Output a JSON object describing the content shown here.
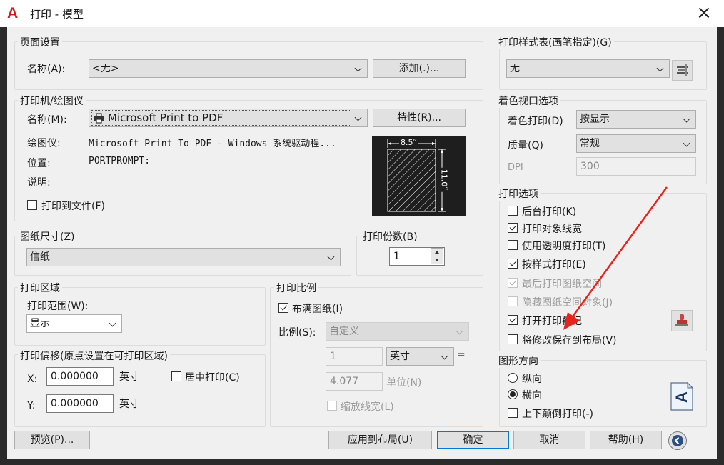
{
  "window": {
    "title": "打印 - 模型",
    "logo": "A",
    "close": "×"
  },
  "page_setup": {
    "group": "页面设置",
    "name_label": "名称(A):",
    "name_value": "<无>",
    "add_button": "添加(.)..."
  },
  "plotter": {
    "group": "打印机/绘图仪",
    "name_label": "名称(M):",
    "printer_value": "Microsoft Print to PDF",
    "properties_button": "特性(R)...",
    "plotter_label": "绘图仪:",
    "plotter_value": "Microsoft Print To PDF - Windows 系统驱动程...",
    "location_label": "位置:",
    "location_value": "PORTPROMPT:",
    "desc_label": "说明:",
    "print_to_file": "打印到文件(F)",
    "preview_width": "8.5′′",
    "preview_height": "11.0′′"
  },
  "paper": {
    "group": "图纸尺寸(Z)",
    "value": "信纸"
  },
  "copies": {
    "group": "打印份数(B)",
    "value": "1"
  },
  "area": {
    "group": "打印区域",
    "range_label": "打印范围(W):",
    "range_value": "显示"
  },
  "offset": {
    "group": "打印偏移(原点设置在可打印区域)",
    "x_label": "X:",
    "x_value": "0.000000",
    "x_unit": "英寸",
    "y_label": "Y:",
    "y_value": "0.000000",
    "y_unit": "英寸",
    "center": "居中打印(C)"
  },
  "scale": {
    "group": "打印比例",
    "fit": "布满图纸(I)",
    "scale_label": "比例(S):",
    "scale_value": "自定义",
    "v1": "1",
    "unit1": "英寸",
    "equals": "=",
    "v2": "4.077",
    "unit2": "单位(N)",
    "lineweights": "缩放线宽(L)"
  },
  "style_table": {
    "group": "打印样式表(画笔指定)(G)",
    "value": "无"
  },
  "shaded": {
    "group": "着色视口选项",
    "shade_label": "着色打印(D)",
    "shade_value": "按显示",
    "quality_label": "质量(Q)",
    "quality_value": "常规",
    "dpi_label": "DPI",
    "dpi_value": "300"
  },
  "options": {
    "group": "打印选项",
    "items": [
      {
        "label": "后台打印(K)"
      },
      {
        "label": "打印对象线宽"
      },
      {
        "label": "使用透明度打印(T)"
      },
      {
        "label": "按样式打印(E)"
      },
      {
        "label": "最后打印图纸空间"
      },
      {
        "label": "隐藏图纸空间对象(J)"
      },
      {
        "label": "打开打印戳记"
      },
      {
        "label": "将修改保存到布局(V)"
      }
    ]
  },
  "orientation": {
    "group": "图形方向",
    "portrait": "纵向",
    "landscape": "横向",
    "upside_down": "上下颠倒打印(-)",
    "glyph": "A"
  },
  "footer": {
    "preview": "预览(P)...",
    "apply": "应用到布局(U)",
    "ok": "确定",
    "cancel": "取消",
    "help": "帮助(H)"
  },
  "colors": {
    "accent": "#0078d7",
    "annotation_arrow": "#e8231c",
    "logo": "#d51a1a"
  }
}
